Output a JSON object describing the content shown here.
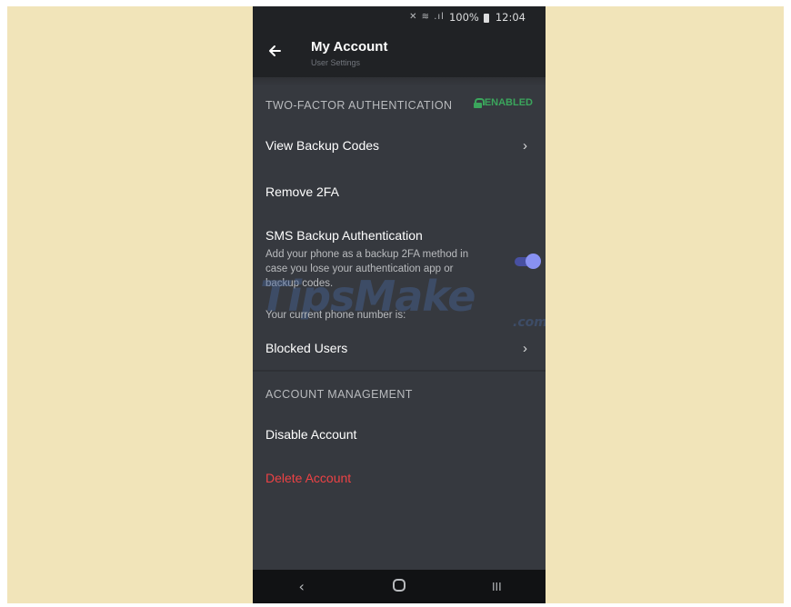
{
  "status_bar": {
    "signal_icons": "✕ ≋ .ıl",
    "battery": "100%",
    "time": "12:04"
  },
  "header": {
    "title": "My Account",
    "subtitle": "User Settings",
    "back_icon": "arrow-left-icon"
  },
  "two_factor": {
    "section_title": "TWO-FACTOR AUTHENTICATION",
    "status": "ENABLED",
    "status_color": "#3ba55c"
  },
  "items": {
    "view_backup_codes": "View Backup Codes",
    "remove_2fa": "Remove 2FA",
    "sms_title": "SMS Backup Authentication",
    "sms_desc": "Add your phone as a backup 2FA method in case you lose your authentication app or backup codes.",
    "sms_enabled": true,
    "phone_number_label": "Your current phone number is:",
    "blocked_users": "Blocked Users"
  },
  "account_management": {
    "section_title": "ACCOUNT MANAGEMENT",
    "disable_account": "Disable Account",
    "delete_account": "Delete Account",
    "delete_color": "#ed4245"
  },
  "watermark": {
    "text": "TipsMake",
    "suffix": ".com"
  },
  "nav": {
    "back": "‹",
    "recents": "III"
  },
  "colors": {
    "background": "#f1e4b9",
    "surface": "#36393f",
    "header": "#202225",
    "accent": "#5865f2"
  }
}
